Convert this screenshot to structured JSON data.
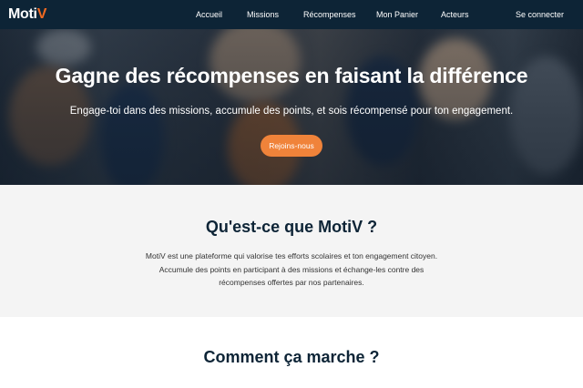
{
  "navbar": {
    "logo_main": "Moti",
    "logo_accent": "V",
    "links": [
      "Accueil",
      "Missions",
      "Récompenses",
      "Mon Panier",
      "Acteurs"
    ],
    "login": "Se connecter"
  },
  "hero": {
    "title": "Gagne des récompenses en faisant la différence",
    "subtitle": "Engage-toi dans des missions, accumule des points, et sois récompensé pour ton engagement.",
    "button": "Rejoins-nous"
  },
  "about": {
    "title": "Qu'est-ce que MotiV ?",
    "text": "MotiV est une plateforme qui valorise tes efforts scolaires et ton engagement citoyen. Accumule des points en participant à des missions et échange-les contre des récompenses offertes par nos partenaires."
  },
  "how": {
    "title": "Comment ça marche ?"
  },
  "colors": {
    "navbar_bg": "#0d2436",
    "accent": "#f26a21",
    "button": "#f0833a",
    "heading": "#0d2436"
  }
}
